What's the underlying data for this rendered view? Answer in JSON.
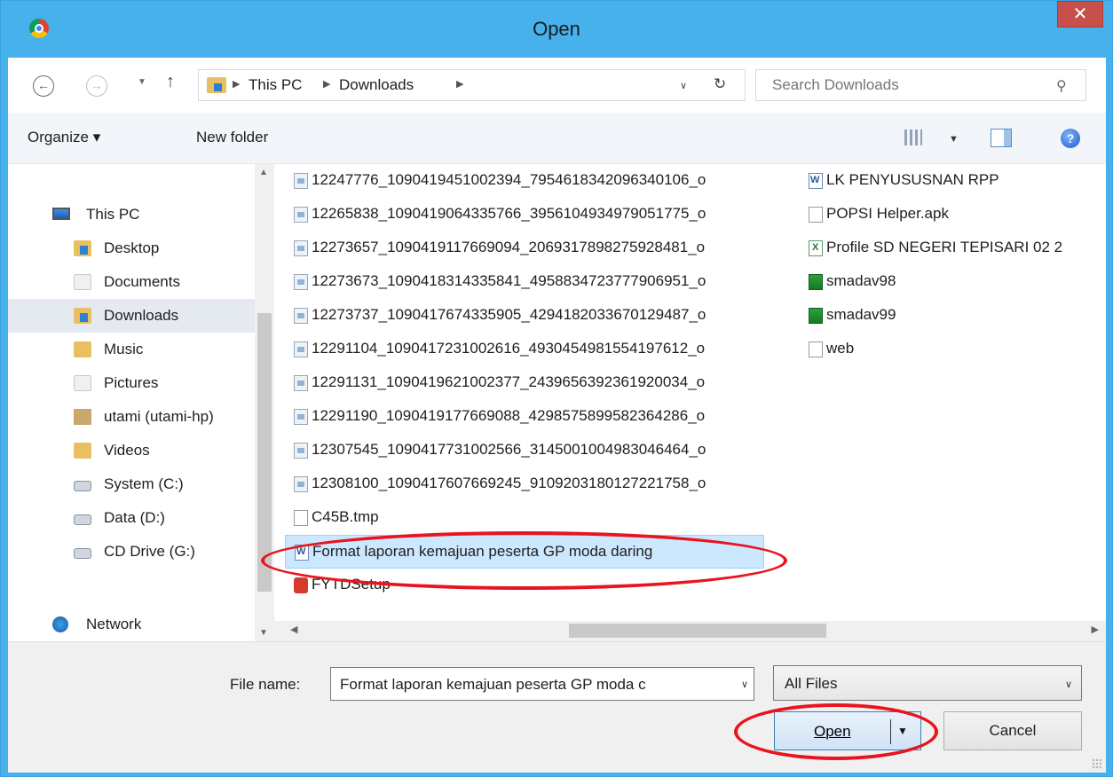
{
  "window": {
    "title": "Open",
    "close_label": "✕"
  },
  "address": {
    "crumbs": [
      "This PC",
      "Downloads"
    ],
    "search_placeholder": "Search Downloads"
  },
  "toolbar": {
    "organize": "Organize ▾",
    "new_folder": "New folder"
  },
  "nav": {
    "items": [
      {
        "label": "This PC",
        "icon": "computer-icon"
      },
      {
        "label": "Desktop",
        "icon": "folder-icon"
      },
      {
        "label": "Documents",
        "icon": "documents-folder-icon"
      },
      {
        "label": "Downloads",
        "icon": "downloads-folder-icon",
        "selected": true
      },
      {
        "label": "Music",
        "icon": "music-folder-icon"
      },
      {
        "label": "Pictures",
        "icon": "pictures-folder-icon"
      },
      {
        "label": "utami (utami-hp)",
        "icon": "network-user-icon"
      },
      {
        "label": "Videos",
        "icon": "videos-folder-icon"
      },
      {
        "label": "System (C:)",
        "icon": "system-drive-icon"
      },
      {
        "label": "Data (D:)",
        "icon": "drive-icon"
      },
      {
        "label": "CD Drive (G:)",
        "icon": "cd-drive-icon"
      },
      {
        "label": "Network",
        "icon": "network-icon"
      }
    ]
  },
  "files": {
    "column1": [
      {
        "name": "12247776_1090419451002394_7954618342096340106_o",
        "icon": "image-file-icon"
      },
      {
        "name": "12265838_1090419064335766_3956104934979051775_o",
        "icon": "image-file-icon"
      },
      {
        "name": "12273657_1090419117669094_2069317898275928481_o",
        "icon": "image-file-icon"
      },
      {
        "name": "12273673_1090418314335841_4958834723777906951_o",
        "icon": "image-file-icon"
      },
      {
        "name": "12273737_1090417674335905_4294182033670129487_o",
        "icon": "image-file-icon"
      },
      {
        "name": "12291104_1090417231002616_4930454981554197612_o",
        "icon": "image-file-icon"
      },
      {
        "name": "12291131_1090419621002377_2439656392361920034_o",
        "icon": "image-file-icon"
      },
      {
        "name": "12291190_1090419177669088_4298575899582364286_o",
        "icon": "image-file-icon"
      },
      {
        "name": "12307545_1090417731002566_3145001004983046464_o",
        "icon": "image-file-icon"
      },
      {
        "name": "12308100_1090417607669245_9109203180127221758_o",
        "icon": "image-file-icon"
      },
      {
        "name": "C45B.tmp",
        "icon": "blank-file-icon"
      },
      {
        "name": "Format laporan kemajuan peserta GP moda daring",
        "icon": "word-document-icon",
        "selected": true
      },
      {
        "name": "FYTDSetup",
        "icon": "setup-app-icon"
      }
    ],
    "column2": [
      {
        "name": "LK PENYUSUSNAN RPP",
        "icon": "word-document-icon"
      },
      {
        "name": "POPSI Helper.apk",
        "icon": "blank-file-icon"
      },
      {
        "name": "Profile SD NEGERI TEPISARI 02 2",
        "icon": "excel-document-icon"
      },
      {
        "name": "smadav98",
        "icon": "smadav-app-icon"
      },
      {
        "name": "smadav99",
        "icon": "smadav-app-icon"
      },
      {
        "name": "web",
        "icon": "blank-file-icon"
      }
    ]
  },
  "bottom": {
    "file_name_label": "File name:",
    "file_name_value": "Format laporan kemajuan peserta GP moda c",
    "filter_value": "All Files",
    "open_label": "Open",
    "cancel_label": "Cancel"
  }
}
